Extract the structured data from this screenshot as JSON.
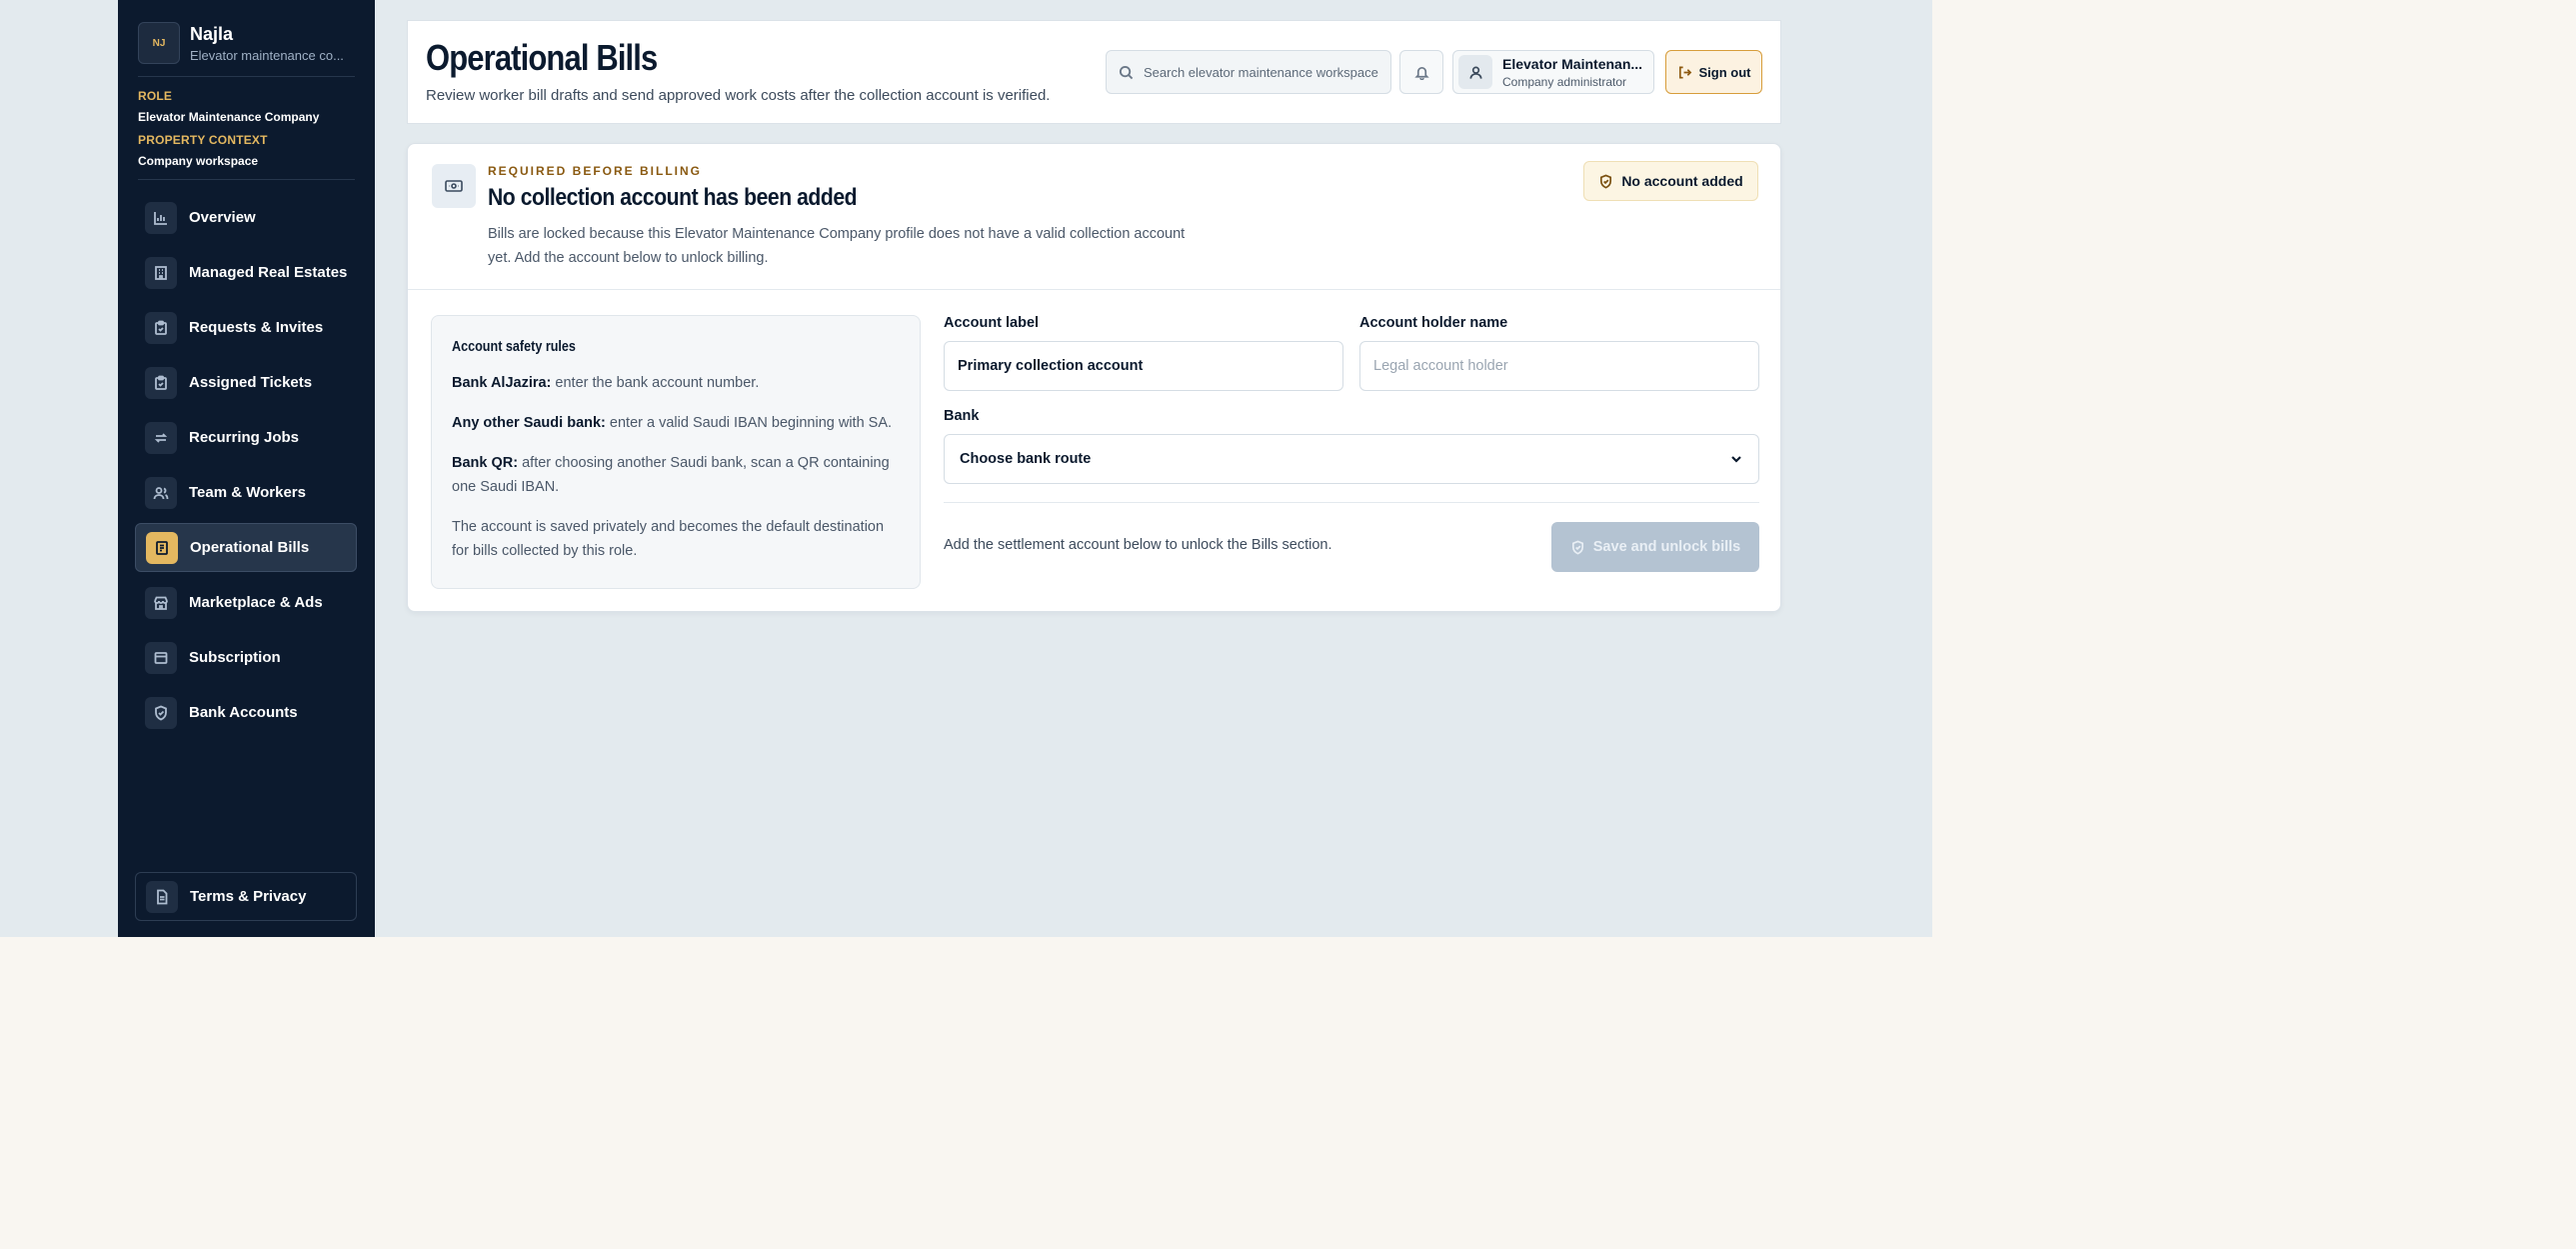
{
  "brand": {
    "logo_text": "NJ",
    "name": "Najla",
    "subtitle": "Elevator maintenance co..."
  },
  "context": {
    "role_label": "ROLE",
    "role_value": "Elevator Maintenance Company",
    "property_label": "PROPERTY CONTEXT",
    "property_value": "Company workspace"
  },
  "sidebar": {
    "items": [
      {
        "label": "Overview",
        "icon": "chart-icon"
      },
      {
        "label": "Managed Real Estates",
        "icon": "building-icon"
      },
      {
        "label": "Requests & Invites",
        "icon": "clipboard-icon"
      },
      {
        "label": "Assigned Tickets",
        "icon": "clipboard-check-icon"
      },
      {
        "label": "Recurring Jobs",
        "icon": "repeat-icon"
      },
      {
        "label": "Team & Workers",
        "icon": "users-icon"
      },
      {
        "label": "Operational Bills",
        "icon": "receipt-icon",
        "active": true
      },
      {
        "label": "Marketplace & Ads",
        "icon": "store-icon"
      },
      {
        "label": "Subscription",
        "icon": "card-icon"
      },
      {
        "label": "Bank Accounts",
        "icon": "shield-icon"
      }
    ],
    "footer": {
      "label": "Terms & Privacy",
      "icon": "document-icon"
    }
  },
  "header": {
    "title": "Operational Bills",
    "subtitle": "Review worker bill drafts and send approved work costs after the collection account is verified.",
    "search_placeholder": "Search elevator maintenance workspace",
    "account_name": "Elevator Maintenan...",
    "account_role": "Company administrator",
    "signout_label": "Sign out"
  },
  "notice": {
    "kicker": "REQUIRED BEFORE BILLING",
    "title": "No collection account has been added",
    "description": "Bills are locked because this Elevator Maintenance Company profile does not have a valid collection account yet. Add the account below to unlock billing.",
    "badge": "No account added"
  },
  "rules": {
    "title": "Account safety rules",
    "items": [
      {
        "bold": "Bank AlJazira:",
        "text": " enter the bank account number."
      },
      {
        "bold": "Any other Saudi bank:",
        "text": " enter a valid Saudi IBAN beginning with SA."
      },
      {
        "bold": "Bank QR:",
        "text": " after choosing another Saudi bank, scan a QR containing one Saudi IBAN."
      }
    ],
    "note": "The account is saved privately and becomes the default destination for bills collected by this role."
  },
  "form": {
    "account_label_label": "Account label",
    "account_label_value": "Primary collection account",
    "holder_label": "Account holder name",
    "holder_placeholder": "Legal account holder",
    "bank_label": "Bank",
    "bank_value": "Choose bank route",
    "hint": "Add the settlement account below to unlock the Bills section.",
    "save_label": "Save and unlock bills"
  },
  "colors": {
    "sidebar_bg": "#0c1a2e",
    "accent": "#e4b860",
    "page_bg": "#e3eaee",
    "disabled_button": "#b4c3d2"
  }
}
